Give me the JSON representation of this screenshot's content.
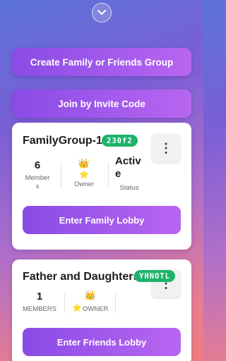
{
  "collapse_icon": "chevron-down-icon",
  "actions": {
    "create_label": "Create Family or Friends Group",
    "join_label": "Join by Invite Code"
  },
  "groups": [
    {
      "name": "FamilyGroup-1",
      "code": "230f2",
      "members_value": "6",
      "members_label_line1": "Member",
      "members_label_line2": "s",
      "owner_label": "Owner",
      "status_value_line1": "Activ",
      "status_value_line2": "e",
      "status_label": "Status",
      "lobby_label": "Enter Family Lobby"
    },
    {
      "name": "Father and Daughters",
      "code": "YHNOTL",
      "members_value": "1",
      "members_label": "MEMBERS",
      "owner_label": "OWNER",
      "lobby_label": "Enter Friends Lobby"
    }
  ],
  "icons": {
    "crown": "👑",
    "star": "⭐",
    "menu": "⋮"
  },
  "colors": {
    "accent": "#9b57ea",
    "badge": "#1fb36b"
  }
}
